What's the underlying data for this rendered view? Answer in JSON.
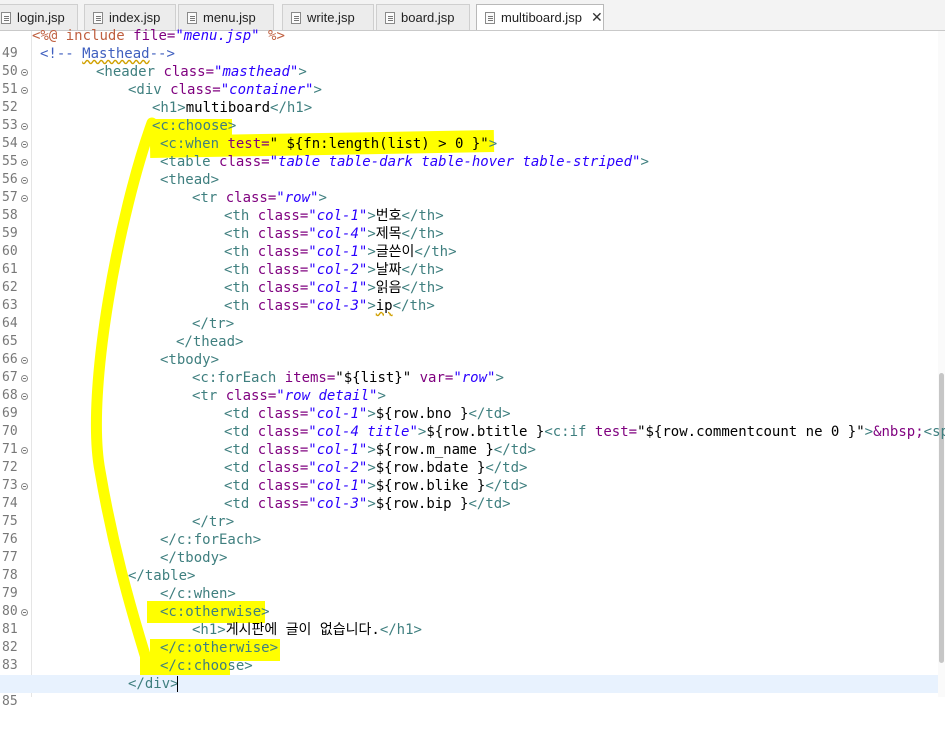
{
  "tabs": [
    {
      "label": "login.jsp"
    },
    {
      "label": "index.jsp"
    },
    {
      "label": "menu.jsp"
    },
    {
      "label": "write.jsp"
    },
    {
      "label": "board.jsp"
    },
    {
      "label": "multiboard.jsp",
      "active": true
    }
  ],
  "code": {
    "l49": {
      "num": "49",
      "a": "<%@",
      "b": " include ",
      "c": "file=",
      "d": "\"menu.jsp\"",
      "e": " %>"
    },
    "l50": {
      "num": "50",
      "a": "<!-- ",
      "b": "Masthead",
      "c": "-->"
    },
    "l51": {
      "num": "51",
      "a": "<header ",
      "b": "class=",
      "c": "\"masthead\"",
      "d": ">"
    },
    "l52": {
      "num": "52",
      "a": "<div ",
      "b": "class=",
      "c": "\"container\"",
      "d": ">"
    },
    "l53": {
      "num": "53",
      "a": "<h1>",
      "b": "multiboard",
      "c": "</h1>"
    },
    "l54": {
      "num": "54",
      "a": "<c:choose>"
    },
    "l55": {
      "num": "55",
      "a": "<c:when ",
      "b": "test=",
      "c": "\" ${fn:length(list) > 0 }\"",
      "d": ">"
    },
    "l56": {
      "num": "56",
      "a": "<table ",
      "b": "class=",
      "c": "\"table table-dark table-hover table-striped\"",
      "d": ">"
    },
    "l57": {
      "num": "57",
      "a": "<thead>"
    },
    "l58": {
      "num": "58",
      "a": "<tr ",
      "b": "class=",
      "c": "\"row\"",
      "d": ">"
    },
    "l59": {
      "num": "59",
      "a": "<th ",
      "b": "class=",
      "c": "\"col-1\"",
      "d": ">",
      "e": "번호",
      "f": "</th>"
    },
    "l60": {
      "num": "60",
      "a": "<th ",
      "b": "class=",
      "c": "\"col-4\"",
      "d": ">",
      "e": "제목",
      "f": "</th>"
    },
    "l61": {
      "num": "61",
      "a": "<th ",
      "b": "class=",
      "c": "\"col-1\"",
      "d": ">",
      "e": "글쓴이",
      "f": "</th>"
    },
    "l62": {
      "num": "62",
      "a": "<th ",
      "b": "class=",
      "c": "\"col-2\"",
      "d": ">",
      "e": "날짜",
      "f": "</th>"
    },
    "l63": {
      "num": "63",
      "a": "<th ",
      "b": "class=",
      "c": "\"col-1\"",
      "d": ">",
      "e": "읽음",
      "f": "</th>"
    },
    "l64": {
      "num": "64",
      "a": "<th ",
      "b": "class=",
      "c": "\"col-3\"",
      "d": ">",
      "e": "ip",
      "f": "</th>"
    },
    "l65": {
      "num": "65",
      "a": "</tr>"
    },
    "l66": {
      "num": "66",
      "a": "</thead>"
    },
    "l67": {
      "num": "67",
      "a": "<tbody>"
    },
    "l68": {
      "num": "68",
      "a": "<c:forEach ",
      "b": "items=",
      "c": "\"${list}\"",
      "d": " var=",
      "e": "\"row\"",
      "f": ">"
    },
    "l69": {
      "num": "69",
      "a": "<tr ",
      "b": "class=",
      "c": "\"row detail\"",
      "d": ">"
    },
    "l70": {
      "num": "70",
      "a": "<td ",
      "b": "class=",
      "c": "\"col-1\"",
      "d": ">",
      "e": "${row.bno }",
      "f": "</td>"
    },
    "l71": {
      "num": "71",
      "a": "<td ",
      "b": "class=",
      "c": "\"col-4 title\"",
      "d": ">",
      "e": "${row.btitle }",
      "f": "<c:if ",
      "g": "test=",
      "h": "\"${row.commentcount ne 0 }\"",
      "i": ">",
      "j": "&nbsp;",
      "k": "<span c"
    },
    "l72": {
      "num": "72",
      "a": "<td ",
      "b": "class=",
      "c": "\"col-1\"",
      "d": ">",
      "e": "${row.m_name }",
      "f": "</td>"
    },
    "l73": {
      "num": "73",
      "a": "<td ",
      "b": "class=",
      "c": "\"col-2\"",
      "d": ">",
      "e": "${row.bdate }",
      "f": "</td>"
    },
    "l74": {
      "num": "74",
      "a": "<td ",
      "b": "class=",
      "c": "\"col-1\"",
      "d": ">",
      "e": "${row.blike }",
      "f": "</td>"
    },
    "l75": {
      "num": "75",
      "a": "<td ",
      "b": "class=",
      "c": "\"col-3\"",
      "d": ">",
      "e": "${row.bip }",
      "f": "</td>"
    },
    "l76": {
      "num": "76",
      "a": "</tr>"
    },
    "l77": {
      "num": "77",
      "a": "</c:forEach>"
    },
    "l78": {
      "num": "78",
      "a": "</tbody>"
    },
    "l79": {
      "num": "79",
      "a": "</table>"
    },
    "l80": {
      "num": "80",
      "a": "</c:when>"
    },
    "l81": {
      "num": "81",
      "a": "<c:otherwise>"
    },
    "l82": {
      "num": "82",
      "a": "<h1>",
      "b": "게시판에 글이 없습니다.",
      "c": "</h1>"
    },
    "l83": {
      "num": "83",
      "a": "</c:otherwise>"
    },
    "l84": {
      "num": "84",
      "a": "</c:choose>"
    },
    "l85": {
      "num": "85",
      "a": "</div>"
    }
  },
  "colors": {
    "highlight": "#ffff00",
    "tag": "#3f7f7f",
    "attribute": "#7f007f",
    "value": "#2a00ff",
    "comment": "#3f5fbf",
    "current_line": "#e8f2fe"
  }
}
